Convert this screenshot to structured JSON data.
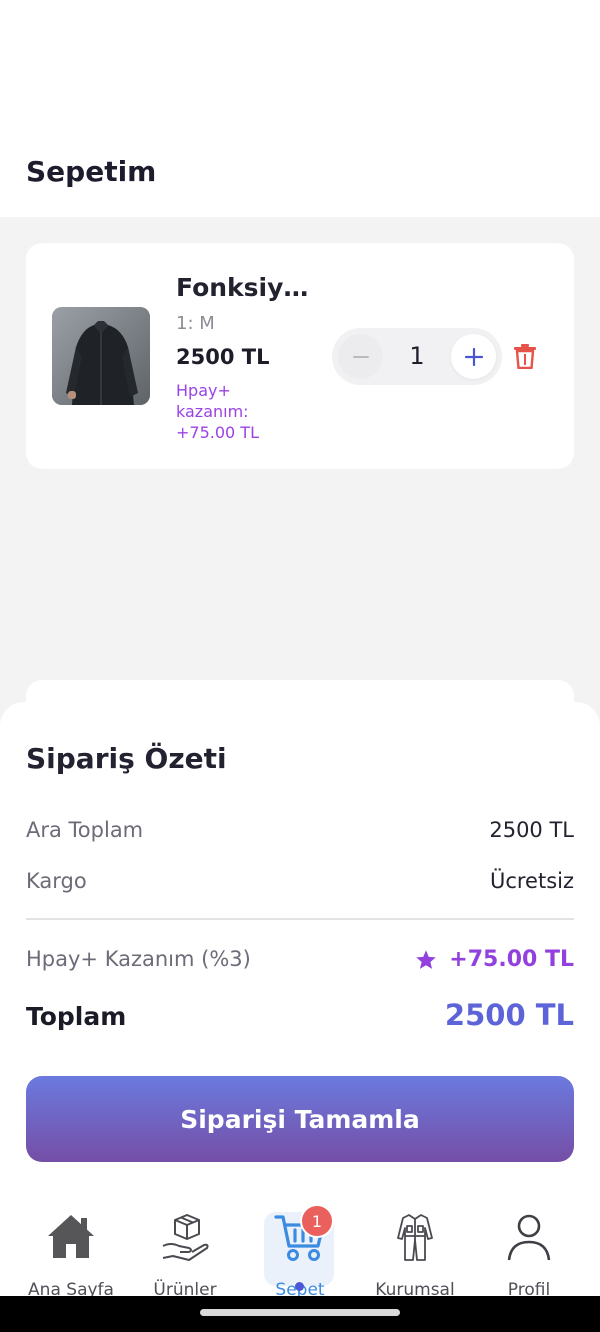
{
  "header": {
    "title": "Sepetim"
  },
  "cart": {
    "items": [
      {
        "name": "Fonksiyonel",
        "size": "1: M",
        "price": "2500 TL",
        "reward": "Hpay+ kazanım: +75.00 TL",
        "quantity": "1"
      }
    ]
  },
  "summary": {
    "title": "Sipariş Özeti",
    "subtotal_label": "Ara Toplam",
    "subtotal_value": "2500 TL",
    "shipping_label": "Kargo",
    "shipping_value": "Ücretsiz",
    "reward_label": "Hpay+ Kazanım (%3)",
    "reward_value": "+75.00 TL",
    "total_label": "Toplam",
    "total_value": "2500 TL",
    "checkout_label": "Siparişi Tamamla"
  },
  "nav": {
    "items": [
      {
        "label": "Ana Sayfa",
        "icon": "home-icon"
      },
      {
        "label": "Ürünler",
        "icon": "products-icon"
      },
      {
        "label": "Sepet",
        "icon": "cart-icon",
        "badge": "1",
        "active": true
      },
      {
        "label": "Kurumsal",
        "icon": "coverall-icon"
      },
      {
        "label": "Profil",
        "icon": "user-icon"
      }
    ]
  },
  "colors": {
    "accent": "#5c64d8",
    "reward": "#9240de",
    "badge": "#e9605c",
    "delete": "#e5534b",
    "checkout_gradient_top": "#6b7adf",
    "checkout_gradient_bottom": "#754ea6"
  }
}
